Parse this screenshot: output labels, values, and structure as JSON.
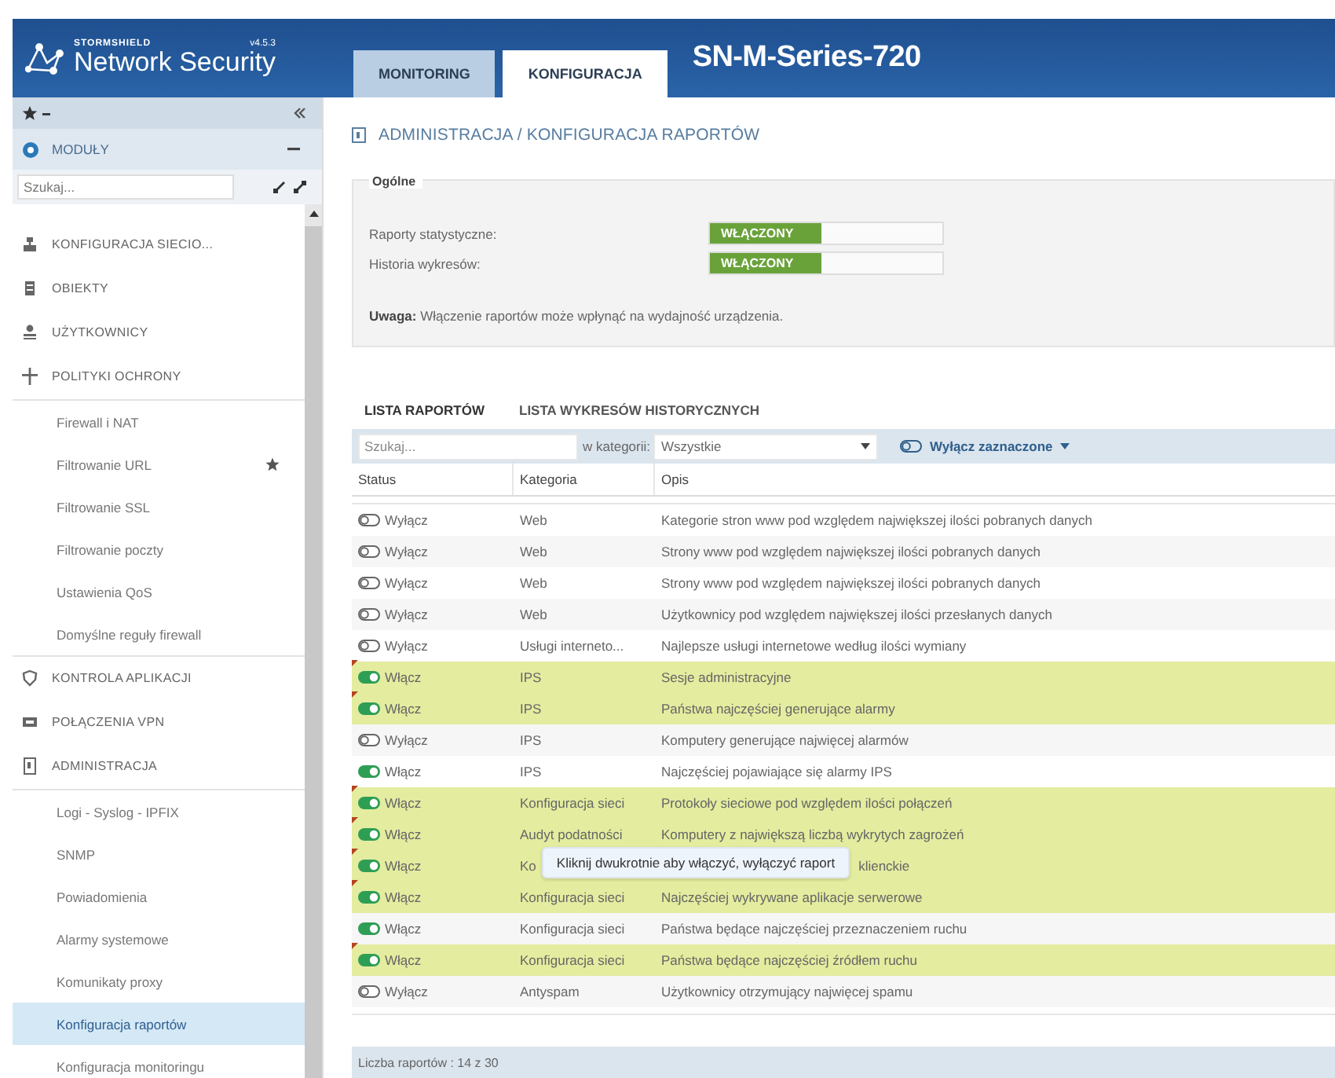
{
  "header": {
    "brand": "STORMSHIELD",
    "version": "v4.5.3",
    "product": "Network Security",
    "device": "SN-M-Series-720"
  },
  "top_tabs": [
    {
      "label": "MONITORING",
      "selected": false
    },
    {
      "label": "KONFIGURACJA",
      "selected": true
    }
  ],
  "sidebar": {
    "modules_label": "MODUŁY",
    "search": {
      "placeholder": "Szukaj..."
    },
    "items": [
      {
        "label": "KONFIGURACJA SIECIO..."
      },
      {
        "label": "OBIEKTY"
      },
      {
        "label": "UŻYTKOWNICY"
      },
      {
        "label": "POLITYKI OCHRONY",
        "children": [
          {
            "label": "Firewall i NAT",
            "starred": false,
            "selected": false
          },
          {
            "label": "Filtrowanie URL",
            "starred": true,
            "selected": false
          },
          {
            "label": "Filtrowanie SSL",
            "starred": false,
            "selected": false
          },
          {
            "label": "Filtrowanie poczty",
            "starred": false,
            "selected": false
          },
          {
            "label": "Ustawienia QoS",
            "starred": false,
            "selected": false
          },
          {
            "label": "Domyślne reguły firewall",
            "starred": false,
            "selected": false
          }
        ]
      },
      {
        "label": "KONTROLA APLIKACJI"
      },
      {
        "label": "POŁĄCZENIA VPN"
      },
      {
        "label": "ADMINISTRACJA",
        "children": [
          {
            "label": "Logi - Syslog - IPFIX",
            "starred": false,
            "selected": false
          },
          {
            "label": "SNMP",
            "starred": false,
            "selected": false
          },
          {
            "label": "Powiadomienia",
            "starred": false,
            "selected": false
          },
          {
            "label": "Alarmy systemowe",
            "starred": false,
            "selected": false
          },
          {
            "label": "Komunikaty proxy",
            "starred": false,
            "selected": false
          },
          {
            "label": "Konfiguracja raportów",
            "starred": false,
            "selected": true
          },
          {
            "label": "Konfiguracja monitoringu",
            "starred": false,
            "selected": false
          }
        ]
      }
    ]
  },
  "breadcrumb": "ADMINISTRACJA / KONFIGURACJA RAPORTÓW",
  "general": {
    "legend": "Ogólne",
    "settings": [
      {
        "label": "Raporty statystyczne:",
        "on": true,
        "state": "WŁĄCZONY"
      },
      {
        "label": "Historia wykresów:",
        "on": true,
        "state": "WŁĄCZONY"
      }
    ],
    "note": "**Uwaga:** Włączenie raportów może wpłynąć na wydajność urządzenia."
  },
  "list_tabs": [
    {
      "label": "LISTA RAPORTÓW",
      "selected": true
    },
    {
      "label": "LISTA WYKRESÓW HISTORYCZNYCH",
      "selected": false
    }
  ],
  "toolbar": {
    "search": {
      "placeholder": "Szukaj..."
    },
    "category_label": "w kategorii:",
    "category_value": "Wszystkie",
    "action": "Wyłącz zaznaczone"
  },
  "table": {
    "columns": [
      "Status",
      "Kategoria",
      "Opis"
    ],
    "rows": [
      {
        "on": false,
        "status": "Wyłącz",
        "category": "Web",
        "description": "Kategorie stron www pod względem największej ilości pobranych danych",
        "modified": false
      },
      {
        "on": false,
        "status": "Wyłącz",
        "category": "Web",
        "description": "Strony www pod względem największej ilości pobranych danych",
        "modified": false
      },
      {
        "on": false,
        "status": "Wyłącz",
        "category": "Web",
        "description": "Strony www pod względem największej ilości pobranych danych",
        "modified": false
      },
      {
        "on": false,
        "status": "Wyłącz",
        "category": "Web",
        "description": "Użytkownicy pod względem największej ilości przesłanych danych",
        "modified": false
      },
      {
        "on": false,
        "status": "Wyłącz",
        "category": "Usługi interneto...",
        "description": "Najlepsze usługi internetowe według ilości wymiany",
        "modified": false
      },
      {
        "on": true,
        "status": "Włącz",
        "category": "IPS",
        "description": "Sesje administracyjne",
        "modified": true
      },
      {
        "on": true,
        "status": "Włącz",
        "category": "IPS",
        "description": "Państwa najczęściej generujące alarmy",
        "modified": true
      },
      {
        "on": false,
        "status": "Wyłącz",
        "category": "IPS",
        "description": "Komputery generujące najwięcej alarmów",
        "modified": false
      },
      {
        "on": true,
        "status": "Włącz",
        "category": "IPS",
        "description": "Najczęściej pojawiające się alarmy IPS",
        "modified": false
      },
      {
        "on": true,
        "status": "Włącz",
        "category": "Konfiguracja sieci",
        "description": "Protokoły sieciowe pod względem ilości połączeń",
        "modified": true
      },
      {
        "on": true,
        "status": "Włącz",
        "category": "Audyt podatności",
        "description": "Komputery z największą liczbą wykrytych zagrożeń",
        "modified": true
      },
      {
        "on": true,
        "status": "Włącz",
        "category": "Ko",
        "description": "klienckie",
        "modified": true,
        "tooltip": "Kliknij dwukrotnie aby włączyć, wyłączyć raport"
      },
      {
        "on": true,
        "status": "Włącz",
        "category": "Konfiguracja sieci",
        "description": "Najczęściej wykrywane aplikacje serwerowe",
        "modified": true
      },
      {
        "on": true,
        "status": "Włącz",
        "category": "Konfiguracja sieci",
        "description": "Państwa będące najczęściej przeznaczeniem ruchu",
        "modified": false
      },
      {
        "on": true,
        "status": "Włącz",
        "category": "Konfiguracja sieci",
        "description": "Państwa będące najczęściej źródłem ruchu",
        "modified": true
      },
      {
        "on": false,
        "status": "Wyłącz",
        "category": "Antyspam",
        "description": "Użytkownicy otrzymujący najwięcej spamu",
        "modified": false
      }
    ],
    "footer": "Liczba raportów : 14 z 30"
  }
}
